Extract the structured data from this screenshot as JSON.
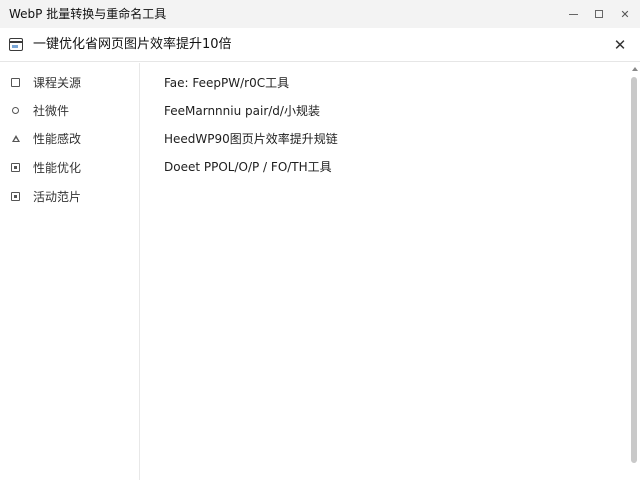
{
  "window": {
    "title": "WebP 批量转换与重命名工具"
  },
  "dialog": {
    "title": "一键优化省网页图片效率提升10倍",
    "close_glyph": "✕"
  },
  "sidebar": {
    "items": [
      {
        "label": "课程关源",
        "icon": "square-icon"
      },
      {
        "label": "社微件",
        "icon": "circle-icon"
      },
      {
        "label": "性能感改",
        "icon": "triangle-icon"
      },
      {
        "label": "性能优化",
        "icon": "box-icon"
      },
      {
        "label": "活动范片",
        "icon": "box-icon"
      }
    ]
  },
  "main": {
    "lines": [
      "Fae: FeepPW/r0C工具",
      "FeeMarnnniu pair/d/小规装",
      "HeedWP90图页片效率提升规链",
      "Doeet PPOL/O/P / FO/TH工具"
    ]
  }
}
